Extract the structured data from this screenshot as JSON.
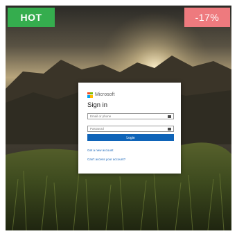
{
  "badges": {
    "hot": "HOT",
    "discount": "-17%"
  },
  "colors": {
    "hot_badge": "#35ad4e",
    "discount_badge": "#ee7a7e",
    "primary_button": "#0f64b8",
    "link": "#1463b8",
    "ms_logo": [
      "#f25022",
      "#7fba00",
      "#00a4ef",
      "#ffb900"
    ]
  },
  "login_card": {
    "brand": "Microsoft",
    "title": "Sign in",
    "email_placeholder": "Email or phone",
    "password_placeholder": "Password",
    "login_button": "Login",
    "create_account_link": "Get a new account",
    "cant_access_link": "Can't access your account?",
    "icons": {
      "email_field": "key-icon",
      "password_field": "key-icon"
    }
  }
}
